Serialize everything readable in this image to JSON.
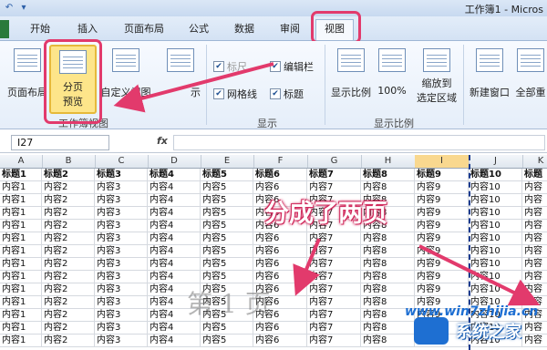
{
  "title": "工作簿1 - Micros",
  "tabs": [
    {
      "label": "开始"
    },
    {
      "label": "插入"
    },
    {
      "label": "页面布局"
    },
    {
      "label": "公式"
    },
    {
      "label": "数据"
    },
    {
      "label": "审阅"
    },
    {
      "label": "视图"
    }
  ],
  "ribbon": {
    "page_layout": "页面布局",
    "page_break_preview_line1": "分页",
    "page_break_preview_line2": "预览",
    "custom_view": "自定义视图",
    "full_screen_fragment": "示",
    "ruler": "标尺",
    "formula_bar": "编辑栏",
    "gridlines": "网格线",
    "headings": "标题",
    "zoom": "显示比例",
    "zoom_100": "100%",
    "zoom_selection_line1": "缩放到",
    "zoom_selection_line2": "选定区域",
    "new_window": "新建窗口",
    "arrange_all": "全部重",
    "group_workbook_views": "工作簿视图",
    "group_show": "显示",
    "group_zoom": "显示比例"
  },
  "formula_bar": {
    "name_box": "I27",
    "fx": "fx"
  },
  "columns": [
    "A",
    "B",
    "C",
    "D",
    "E",
    "F",
    "G",
    "H",
    "I",
    "J",
    "K"
  ],
  "selected_column": "I",
  "header_row": [
    "标题1",
    "标题2",
    "标题3",
    "标题4",
    "标题5",
    "标题6",
    "标题7",
    "标题8",
    "标题9",
    "标题10",
    "标题"
  ],
  "data_rows": [
    [
      "内容1",
      "内容2",
      "内容3",
      "内容4",
      "内容5",
      "内容6",
      "内容7",
      "内容8",
      "内容9",
      "内容10",
      "内容"
    ],
    [
      "内容1",
      "内容2",
      "内容3",
      "内容4",
      "内容5",
      "内容6",
      "内容7",
      "内容8",
      "内容9",
      "内容10",
      "内容"
    ],
    [
      "内容1",
      "内容2",
      "内容3",
      "内容4",
      "内容5",
      "内容6",
      "内容7",
      "内容8",
      "内容9",
      "内容10",
      "内容"
    ],
    [
      "内容1",
      "内容2",
      "内容3",
      "内容4",
      "内容5",
      "内容6",
      "内容7",
      "内容8",
      "内容9",
      "内容10",
      "内容"
    ],
    [
      "内容1",
      "内容2",
      "内容3",
      "内容4",
      "内容5",
      "内容6",
      "内容7",
      "内容8",
      "内容9",
      "内容10",
      "内容"
    ],
    [
      "内容1",
      "内容2",
      "内容3",
      "内容4",
      "内容5",
      "内容6",
      "内容7",
      "内容8",
      "内容9",
      "内容10",
      "内容"
    ],
    [
      "内容1",
      "内容2",
      "内容3",
      "内容4",
      "内容5",
      "内容6",
      "内容7",
      "内容8",
      "内容9",
      "内容10",
      "内容"
    ],
    [
      "内容1",
      "内容2",
      "内容3",
      "内容4",
      "内容5",
      "内容6",
      "内容7",
      "内容8",
      "内容9",
      "内容10",
      "内容"
    ],
    [
      "内容1",
      "内容2",
      "内容3",
      "内容4",
      "内容5",
      "内容6",
      "内容7",
      "内容8",
      "内容9",
      "内容10",
      "内容"
    ],
    [
      "内容1",
      "内容2",
      "内容3",
      "内容4",
      "内容5",
      "内容6",
      "内容7",
      "内容8",
      "内容9",
      "内容10",
      "内容"
    ],
    [
      "内容1",
      "内容2",
      "内容3",
      "内容4",
      "内容5",
      "内容6",
      "内容7",
      "内容8",
      "内容9",
      "内容10",
      "内容"
    ],
    [
      "内容1",
      "内容2",
      "内容3",
      "内容4",
      "内容5",
      "内容6",
      "内容7",
      "内容8",
      "内容9",
      "内容10",
      "内容"
    ],
    [
      "内容1",
      "内容2",
      "内容3",
      "内容4",
      "内容5",
      "内容6",
      "内容7",
      "内容8",
      "内容9",
      "内容10",
      "内容"
    ]
  ],
  "page_watermark": "第 1 页",
  "annotation": "分成了两页",
  "brand": {
    "watermark": "www.win7zhijia.cn",
    "site_name": "系统之家"
  },
  "colors": {
    "highlight": "#e23a6c",
    "selected_column": "#f9d88f",
    "page_break_line": "#1c3c8f",
    "page_break_button": "#fde58a"
  }
}
